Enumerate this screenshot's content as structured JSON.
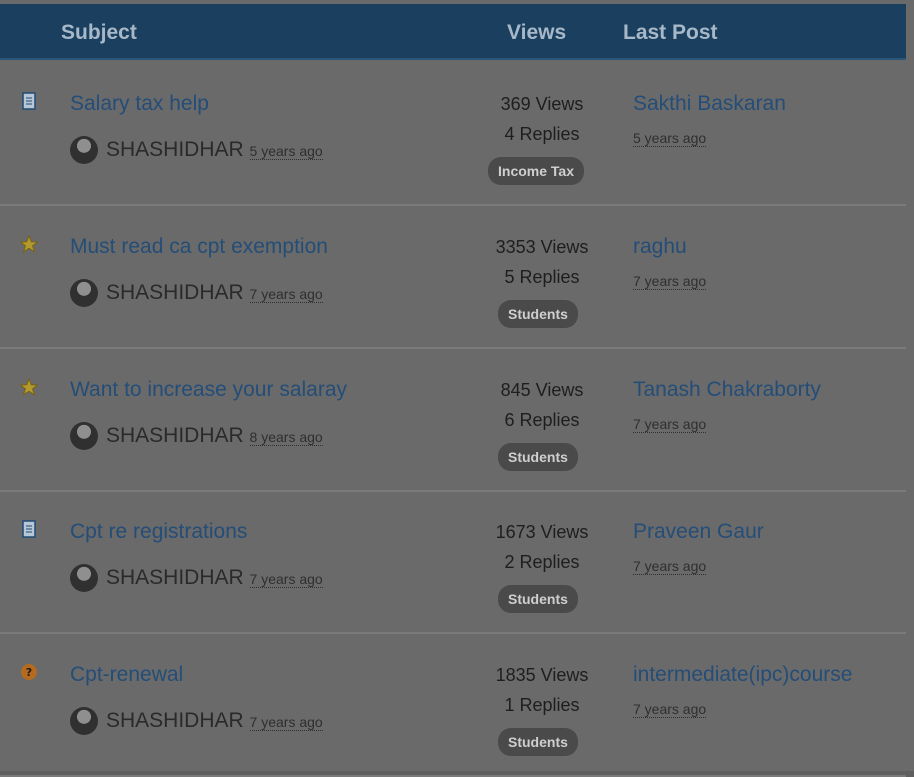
{
  "header": {
    "subject": "Subject",
    "views": "Views",
    "last_post": "Last Post"
  },
  "threads": [
    {
      "icon": "document-icon",
      "title": "Salary tax help",
      "author": "SHASHIDHAR",
      "time": "5 years ago",
      "views": "369 Views",
      "replies": "4 Replies",
      "category": "Income Tax",
      "last_post_user": "Sakthi Baskaran",
      "last_post_time": "5 years ago"
    },
    {
      "icon": "star-icon",
      "title": "Must read ca cpt exemption",
      "author": "SHASHIDHAR",
      "time": "7 years ago",
      "views": "3353 Views",
      "replies": "5 Replies",
      "category": "Students",
      "last_post_user": "raghu",
      "last_post_time": "7 years ago"
    },
    {
      "icon": "star-icon",
      "title": "Want to increase your salaray",
      "author": "SHASHIDHAR",
      "time": "8 years ago",
      "views": "845 Views",
      "replies": "6 Replies",
      "category": "Students",
      "last_post_user": "Tanash Chakraborty",
      "last_post_time": "7 years ago"
    },
    {
      "icon": "document-icon",
      "title": "Cpt re registrations",
      "author": "SHASHIDHAR",
      "time": "7 years ago",
      "views": "1673 Views",
      "replies": "2 Replies",
      "category": "Students",
      "last_post_user": "Praveen Gaur",
      "last_post_time": "7 years ago"
    },
    {
      "icon": "question-icon",
      "title": "Cpt-renewal",
      "author": "SHASHIDHAR",
      "time": "7 years ago",
      "views": "1835 Views",
      "replies": "1 Replies",
      "category": "Students",
      "last_post_user": "intermediate(ipc)course",
      "last_post_time": "7 years ago"
    }
  ],
  "colors": {
    "header": "#1b3f5e",
    "link": "#244d78",
    "badge": "#4a4a4a",
    "background": "#6a6a6a"
  }
}
